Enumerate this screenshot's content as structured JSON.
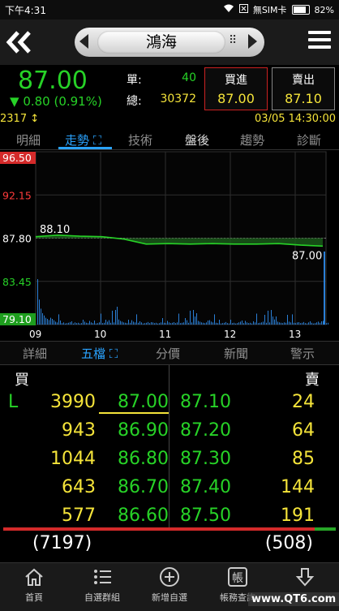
{
  "status_bar": {
    "time": "下午4:31",
    "sim": "無SIM卡",
    "battery": "82%"
  },
  "header": {
    "stock_name": "鴻海"
  },
  "quote": {
    "price": "87.00",
    "change": "0.80 (0.91%)",
    "unit_label": "單:",
    "unit_value": "40",
    "total_label": "總:",
    "total_value": "30372",
    "bid_label": "買進",
    "bid_value": "87.00",
    "ask_label": "賣出",
    "ask_value": "87.10",
    "code": "2317",
    "datetime": "03/05 14:30:00"
  },
  "tabs_top": [
    {
      "label": "明細"
    },
    {
      "label": "走勢"
    },
    {
      "label": "技術"
    },
    {
      "label": "盤後"
    },
    {
      "label": "趨勢"
    },
    {
      "label": "診斷"
    }
  ],
  "chart_data": {
    "type": "line",
    "y_ticks": [
      "96.50",
      "92.15",
      "87.80",
      "83.45",
      "79.10"
    ],
    "ylim": [
      79.1,
      96.5
    ],
    "x_ticks": [
      "09",
      "10",
      "11",
      "12",
      "13"
    ],
    "x": [
      "09:00",
      "09:15",
      "09:30",
      "09:45",
      "10:00",
      "10:15",
      "10:30",
      "11:00",
      "11:30",
      "12:00",
      "12:30",
      "13:00",
      "13:15",
      "13:30"
    ],
    "values": [
      87.95,
      88.1,
      88.0,
      87.95,
      87.7,
      87.2,
      87.25,
      87.2,
      87.25,
      87.2,
      87.2,
      87.25,
      87.1,
      87.0
    ],
    "reference": 87.8,
    "annotations": [
      "88.10",
      "87.00"
    ],
    "colors": {
      "line": "#27d227",
      "up": "#ff3b3b",
      "down": "#27d227",
      "volume": "#2a7fd6"
    }
  },
  "tabs_bottom": [
    {
      "label": "詳細"
    },
    {
      "label": "五檔"
    },
    {
      "label": "分價"
    },
    {
      "label": "新聞"
    },
    {
      "label": "警示"
    }
  ],
  "order_book": {
    "bid_header": "買",
    "ask_header": "賣",
    "marker": "L",
    "rows": [
      {
        "bid_vol": "3990",
        "bid": "87.00",
        "ask": "87.10",
        "ask_vol": "24"
      },
      {
        "bid_vol": "943",
        "bid": "86.90",
        "ask": "87.20",
        "ask_vol": "64"
      },
      {
        "bid_vol": "1044",
        "bid": "86.80",
        "ask": "87.30",
        "ask_vol": "85"
      },
      {
        "bid_vol": "643",
        "bid": "86.70",
        "ask": "87.40",
        "ask_vol": "144"
      },
      {
        "bid_vol": "577",
        "bid": "86.60",
        "ask": "87.50",
        "ask_vol": "191"
      }
    ],
    "bid_total": "(7197)",
    "ask_total": "(508)"
  },
  "bottom_nav": [
    {
      "label": "首頁",
      "icon": "home-icon"
    },
    {
      "label": "自選群組",
      "icon": "list-icon"
    },
    {
      "label": "新增自選",
      "icon": "add-circle-icon"
    },
    {
      "label": "帳務查詢",
      "icon": "account-icon"
    },
    {
      "label": "",
      "icon": "download-arrow-icon"
    }
  ],
  "watermark": "www.QT6.com"
}
